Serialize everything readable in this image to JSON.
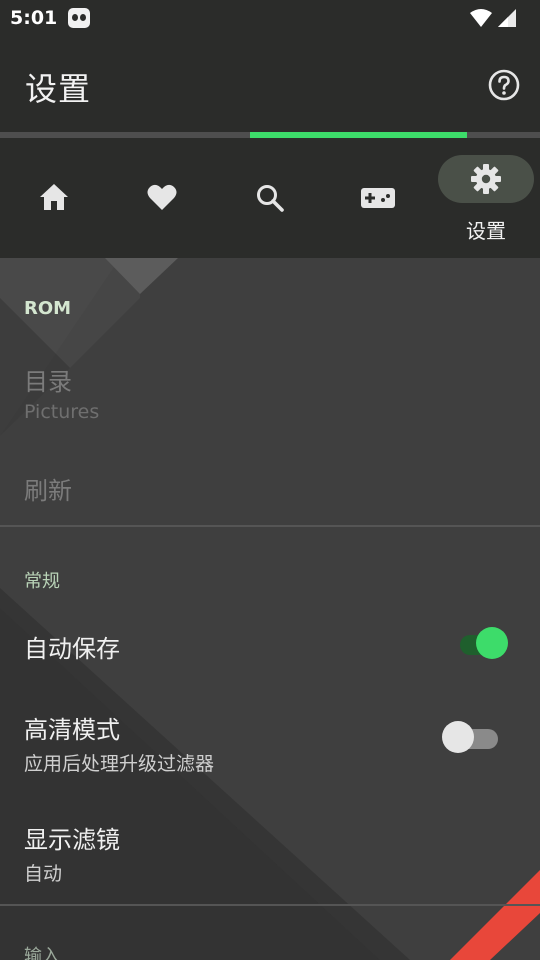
{
  "status": {
    "time": "5:01"
  },
  "appbar": {
    "title": "设置"
  },
  "nav": {
    "items": [
      {
        "icon": "home-icon"
      },
      {
        "icon": "heart-icon"
      },
      {
        "icon": "search-icon"
      },
      {
        "icon": "gamepad-icon"
      },
      {
        "icon": "gear-icon",
        "label": "设置",
        "active": true
      }
    ]
  },
  "settings": {
    "rom_section": "ROM",
    "directory": {
      "title": "目录",
      "subtitle": "Pictures"
    },
    "refresh": {
      "title": "刷新"
    },
    "general_section": "常规",
    "autosave": {
      "title": "自动保存",
      "enabled": true
    },
    "hd_mode": {
      "title": "高清模式",
      "subtitle": "应用后处理升级过滤器",
      "enabled": false
    },
    "show_filter": {
      "title": "显示滤镜",
      "subtitle": "自动"
    },
    "input_section": "输入"
  },
  "colors": {
    "accent": "#3ddc6a",
    "bar": "#2b2c2a",
    "background": "#3f3f3f",
    "warning_stripe": "#e8473a"
  }
}
